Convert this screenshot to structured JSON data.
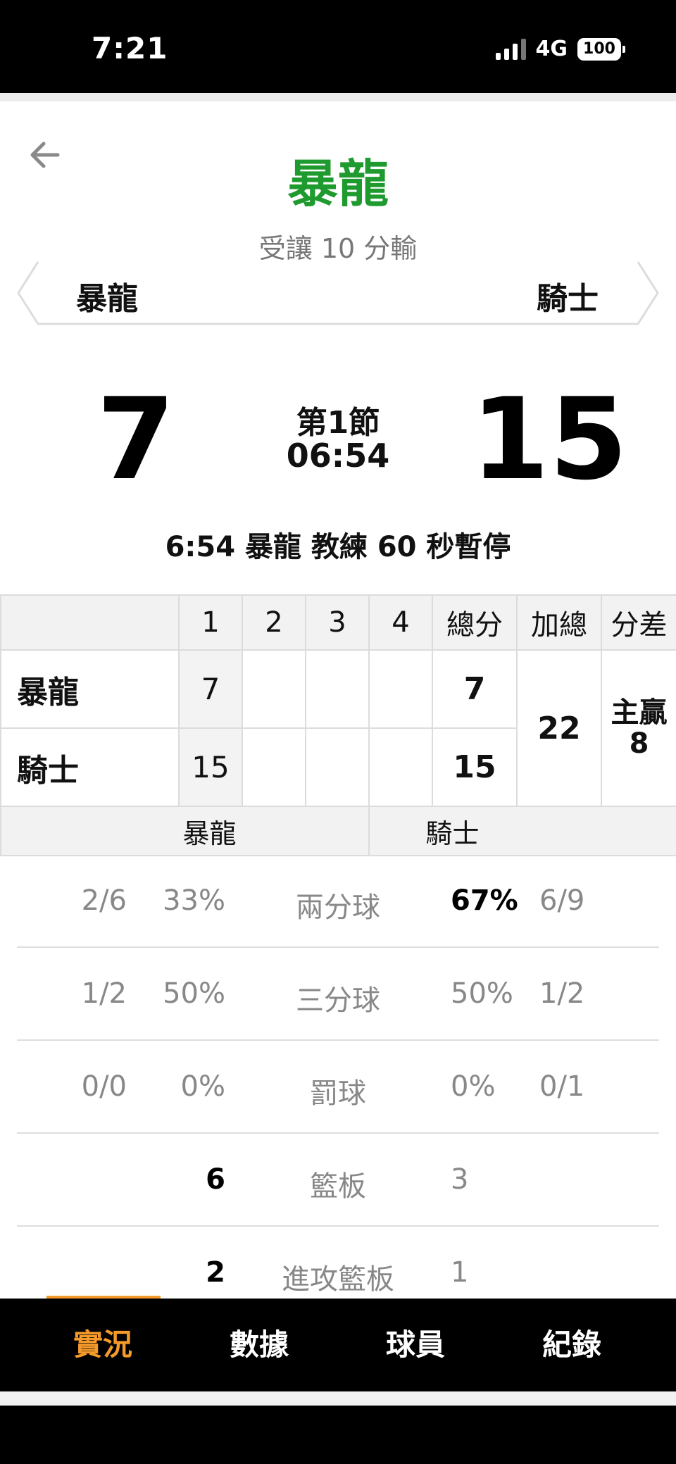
{
  "status": {
    "time": "7:21",
    "network": "4G",
    "battery": "100"
  },
  "header": {
    "title": "暴龍",
    "spread_text": "受讓 10 分輸",
    "team_left": "暴龍",
    "team_right": "騎士"
  },
  "scoreboard": {
    "home_score": "7",
    "away_score": "15",
    "period": "第1節",
    "clock": "06:54",
    "event": "6:54 暴龍  教練 60 秒暫停"
  },
  "box": {
    "headers": [
      "",
      "1",
      "2",
      "3",
      "4",
      "總分",
      "加總",
      "分差"
    ],
    "rows": [
      {
        "team": "暴龍",
        "q1": "7",
        "q2": "",
        "q3": "",
        "q4": "",
        "total": "7"
      },
      {
        "team": "騎士",
        "q1": "15",
        "q2": "",
        "q3": "",
        "q4": "",
        "total": "15"
      }
    ],
    "combined": "22",
    "diff_label": "主贏",
    "diff_value": "8",
    "footer_left": "暴龍",
    "footer_right": "騎士"
  },
  "stats": [
    {
      "label": "兩分球",
      "left_frac": "2/6",
      "left_pct": "33%",
      "right_pct": "67%",
      "right_frac": "6/9"
    },
    {
      "label": "三分球",
      "left_frac": "1/2",
      "left_pct": "50%",
      "right_pct": "50%",
      "right_frac": "1/2"
    },
    {
      "label": "罰球",
      "left_frac": "0/0",
      "left_pct": "0%",
      "right_pct": "0%",
      "right_frac": "0/1"
    },
    {
      "label": "籃板",
      "left_frac": "",
      "left_pct": "6",
      "right_pct": "3",
      "right_frac": ""
    },
    {
      "label": "進攻籃板",
      "left_frac": "",
      "left_pct": "2",
      "right_pct": "1",
      "right_frac": ""
    }
  ],
  "tabs": [
    {
      "label": "實況",
      "active": true
    },
    {
      "label": "數據",
      "active": false
    },
    {
      "label": "球員",
      "active": false
    },
    {
      "label": "紀錄",
      "active": false
    }
  ],
  "colors": {
    "title_green": "#1e9a2e",
    "accent_orange": "#f39a2b"
  },
  "icons": {
    "back": "arrow-left-icon"
  }
}
